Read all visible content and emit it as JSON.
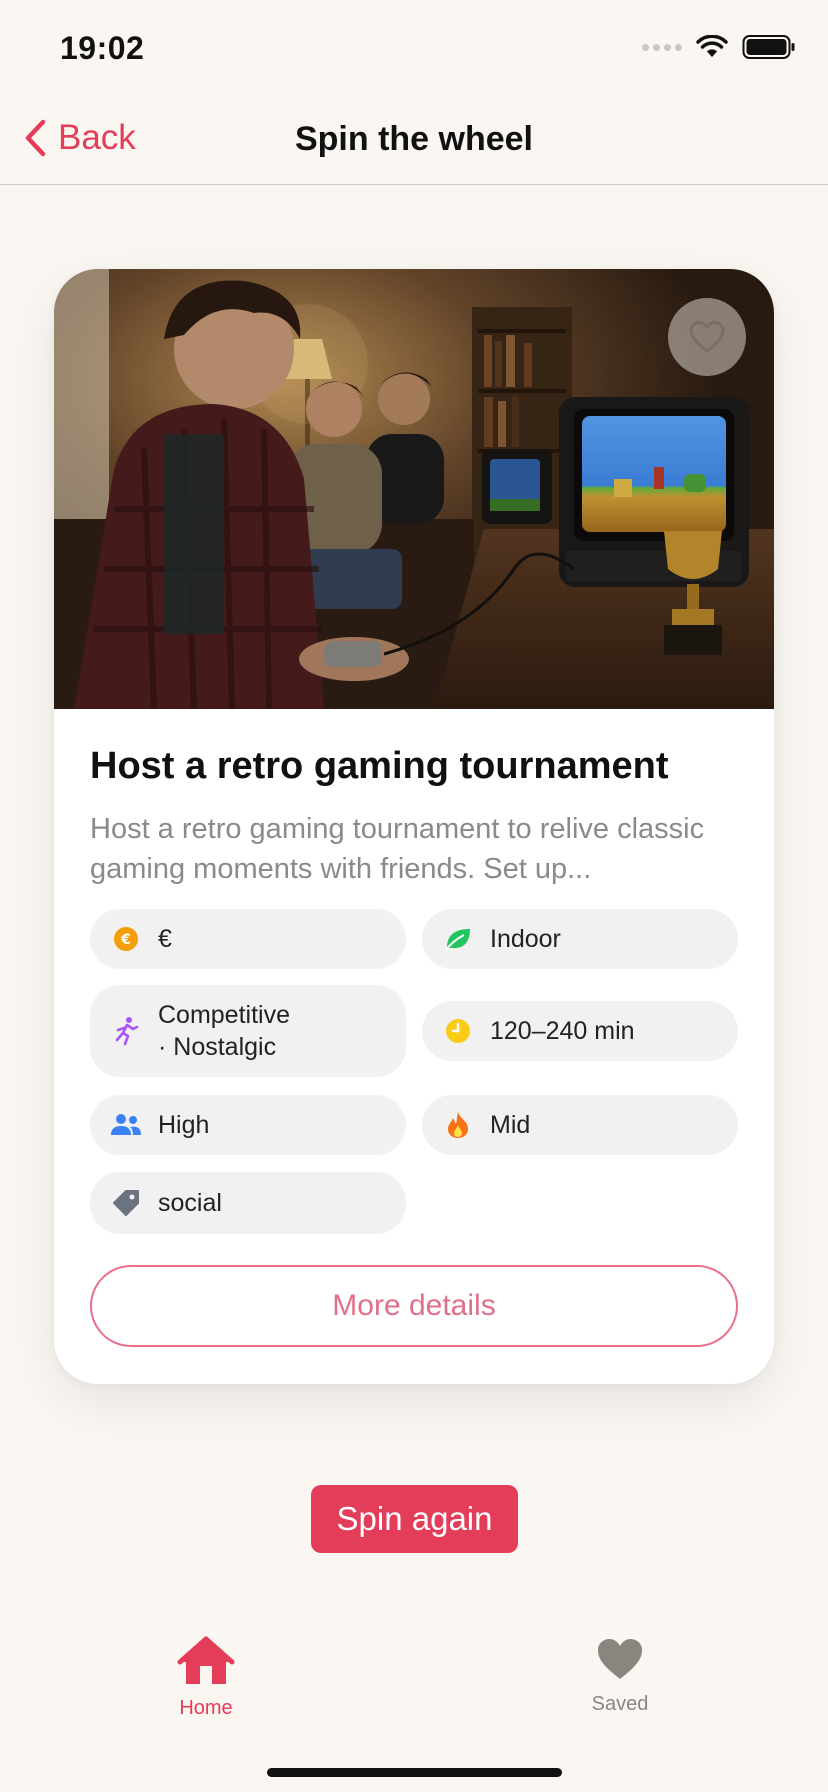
{
  "status_bar": {
    "time": "19:02"
  },
  "nav": {
    "back_label": "Back",
    "title": "Spin the wheel"
  },
  "card": {
    "image_alt": "Friends playing retro video games on CRT televisions with a trophy",
    "title": "Host a retro gaming tournament",
    "description": "Host a retro gaming tournament to relive classic gaming moments with friends. Set up...",
    "chips": [
      {
        "icon": "euro-coin-icon",
        "label": "€",
        "color": "#f59e0b"
      },
      {
        "icon": "leaf-icon",
        "label": "Indoor",
        "color": "#22c55e"
      },
      {
        "icon": "running-person-icon",
        "label": "Competitive\n· Nostalgic",
        "color": "#a855f7"
      },
      {
        "icon": "clock-icon",
        "label": "120–240 min",
        "color": "#facc15"
      },
      {
        "icon": "people-icon",
        "label": "High",
        "color": "#3b82f6"
      },
      {
        "icon": "flame-icon",
        "label": "Mid",
        "color": "#f97316"
      },
      {
        "icon": "tag-icon",
        "label": "social",
        "color": "#6b7280"
      }
    ],
    "more_button": "More details"
  },
  "spin_button": "Spin again",
  "tabs": [
    {
      "label": "Home",
      "icon": "home-icon",
      "active": true
    },
    {
      "label": "Saved",
      "icon": "heart-icon",
      "active": false
    }
  ],
  "colors": {
    "accent": "#e43d5a",
    "background": "#faf6f1"
  }
}
